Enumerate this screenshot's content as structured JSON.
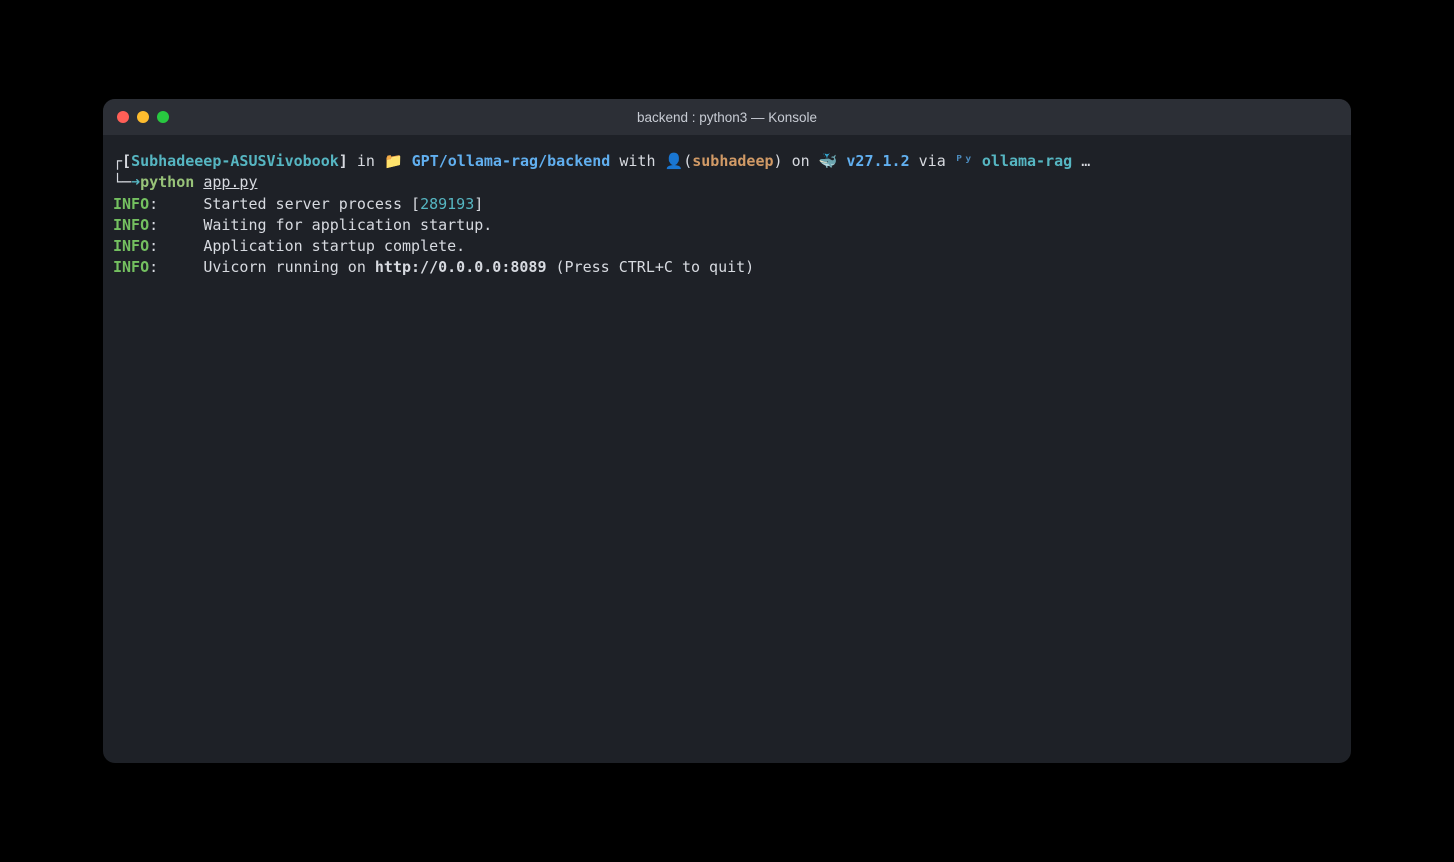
{
  "window": {
    "title": "backend : python3 — Konsole"
  },
  "prompt": {
    "corner_top": "┌[",
    "host": "Subhadeeep-ASUSVivobook",
    "close_bracket": "]",
    "in": " in ",
    "folder_icon": "📁",
    "path": " GPT/ollama-rag/backend",
    "with": " with ",
    "user_icon": "👤",
    "paren_open": "(",
    "user": "subhadeep",
    "paren_close": ")",
    "on": " on ",
    "whale_icon": "🐳",
    "version": " v27.1.2",
    "via": " via ",
    "py_icon": "ᴾʸ",
    "env": " ollama-rag ",
    "ellipsis": "…",
    "corner_bottom": "└─",
    "arrow": "➜",
    "cmd": "python",
    "arg": "app.py"
  },
  "logs": [
    {
      "level": "INFO",
      "colon": ":     ",
      "pre": "Started server process [",
      "pid": "289193",
      "post": "]"
    },
    {
      "level": "INFO",
      "colon": ":     ",
      "pre": "Waiting for application startup.",
      "pid": "",
      "post": ""
    },
    {
      "level": "INFO",
      "colon": ":     ",
      "pre": "Application startup complete.",
      "pid": "",
      "post": ""
    },
    {
      "level": "INFO",
      "colon": ":     ",
      "pre": "Uvicorn running on ",
      "url": "http://0.0.0.0:8089",
      "post": " (Press CTRL+C to quit)"
    }
  ]
}
